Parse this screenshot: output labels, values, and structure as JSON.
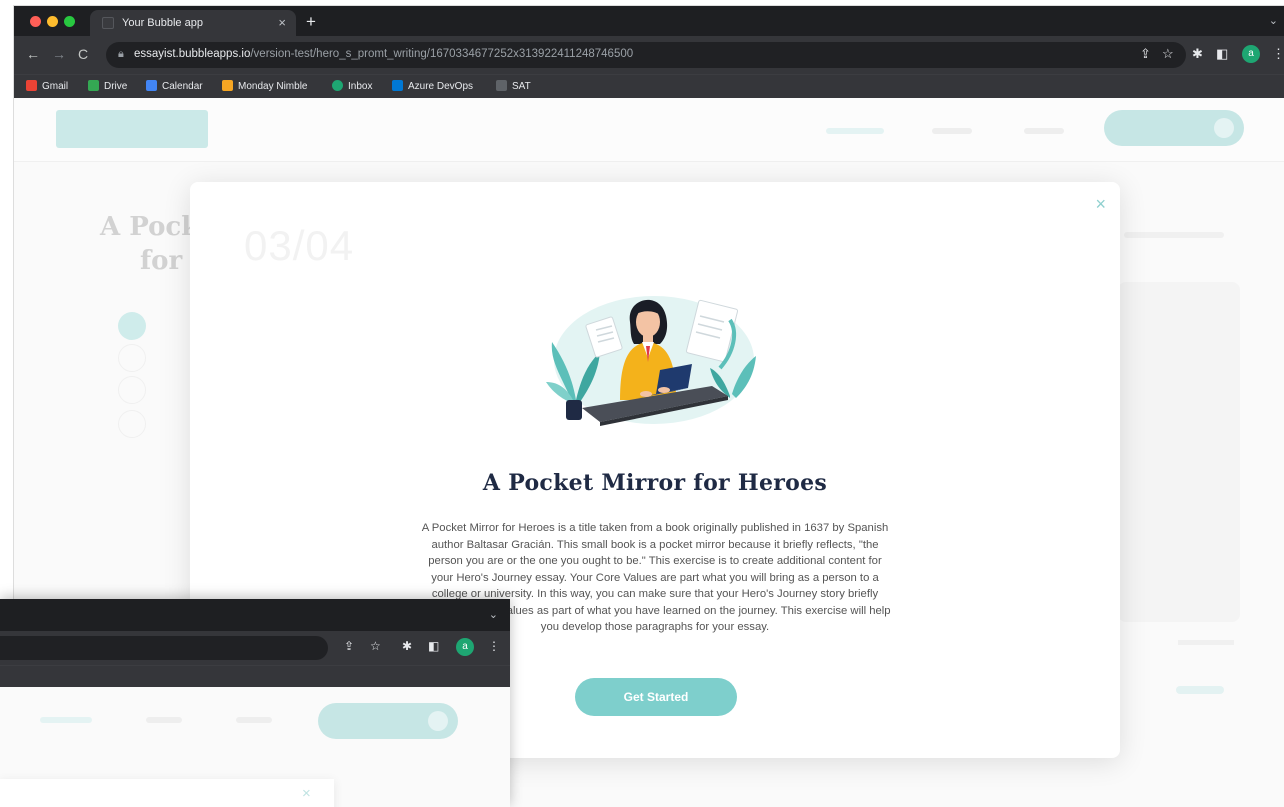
{
  "browser": {
    "tab_title": "Your Bubble app",
    "tab_close": "×",
    "new_tab": "+",
    "corner_arrow": "⌄",
    "url_host": "essayist.bubbleapps.io",
    "url_path": "/version-test/hero_s_promt_writing/1670334677252x313922411248746500",
    "avatar_letter": "a",
    "bookmarks": [
      "Gmail",
      "Drive",
      "Calendar",
      "Monday Nimble",
      "Inbox",
      "Azure DevOps",
      "SAT"
    ]
  },
  "page": {
    "step_counter": "03/04",
    "heading_line1": "A Pock",
    "heading_line2": "for H"
  },
  "modal": {
    "close_label": "×",
    "title": "A Pocket Mirror for Heroes",
    "description": "A Pocket Mirror for Heroes is a title taken from a book originally published in 1637 by Spanish author Baltasar Gracián. This small book is a pocket mirror because it briefly reflects, \"the person you are or the one you ought to be.\" This exercise is to create additional content for your Hero's Journey essay. Your Core Values are part what you will bring as a person to a college or university. In this way, you can make sure that your Hero's Journey story briefly highlights those values as part of what you have learned on the journey. This exercise will help you develop those paragraphs for your essay.",
    "cta_label": "Get Started"
  },
  "browser2": {
    "chevron": "⌄",
    "avatar_letter": "a",
    "close_label": "×"
  },
  "colors": {
    "accent_teal": "#7ecfcc",
    "title_navy": "#1f2a44",
    "chrome_dark": "#35363a"
  }
}
